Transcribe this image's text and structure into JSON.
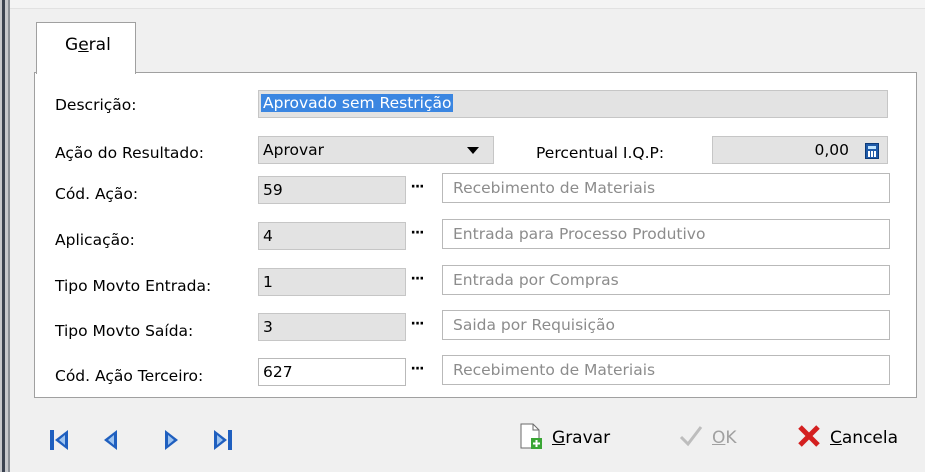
{
  "tab": {
    "label_prefix": "G",
    "label_underlined": "e",
    "label_suffix": "ral"
  },
  "form": {
    "descricao": {
      "label": "Descrição:",
      "value": "Aprovado sem Restrição"
    },
    "acao_resultado": {
      "label": "Ação do Resultado:",
      "value": "Aprovar"
    },
    "percentual": {
      "label": "Percentual I.Q.P:",
      "value": "0,00"
    },
    "cod_acao": {
      "label": "Cód. Ação:",
      "code": "59",
      "desc": "Recebimento de Materiais"
    },
    "aplicacao": {
      "label": "Aplicação:",
      "code": "4",
      "desc": "Entrada para Processo Produtivo"
    },
    "tipo_entrada": {
      "label": "Tipo Movto Entrada:",
      "code": "1",
      "desc": "Entrada por Compras"
    },
    "tipo_saida": {
      "label": "Tipo Movto Saída:",
      "code": "3",
      "desc": "Saida por Requisição"
    },
    "cod_terceiro": {
      "label": "Cód. Ação Terceiro:",
      "code": "627",
      "desc": "Recebimento de Materiais"
    },
    "ellipsis": "···"
  },
  "buttons": {
    "gravar": {
      "u": "G",
      "rest": "ravar"
    },
    "ok": {
      "u": "O",
      "rest": "K"
    },
    "cancela": {
      "u": "C",
      "rest": "ancela"
    }
  },
  "colors": {
    "selection": "#3b86e1",
    "nav_blue": "#1f5fbf",
    "cancel_red": "#d42020",
    "save_green": "#3aa635"
  },
  "icons": [
    "first-record-icon",
    "previous-record-icon",
    "next-record-icon",
    "last-record-icon",
    "calculator-icon",
    "save-document-icon",
    "check-icon",
    "cancel-x-icon",
    "dropdown-arrow-icon"
  ]
}
